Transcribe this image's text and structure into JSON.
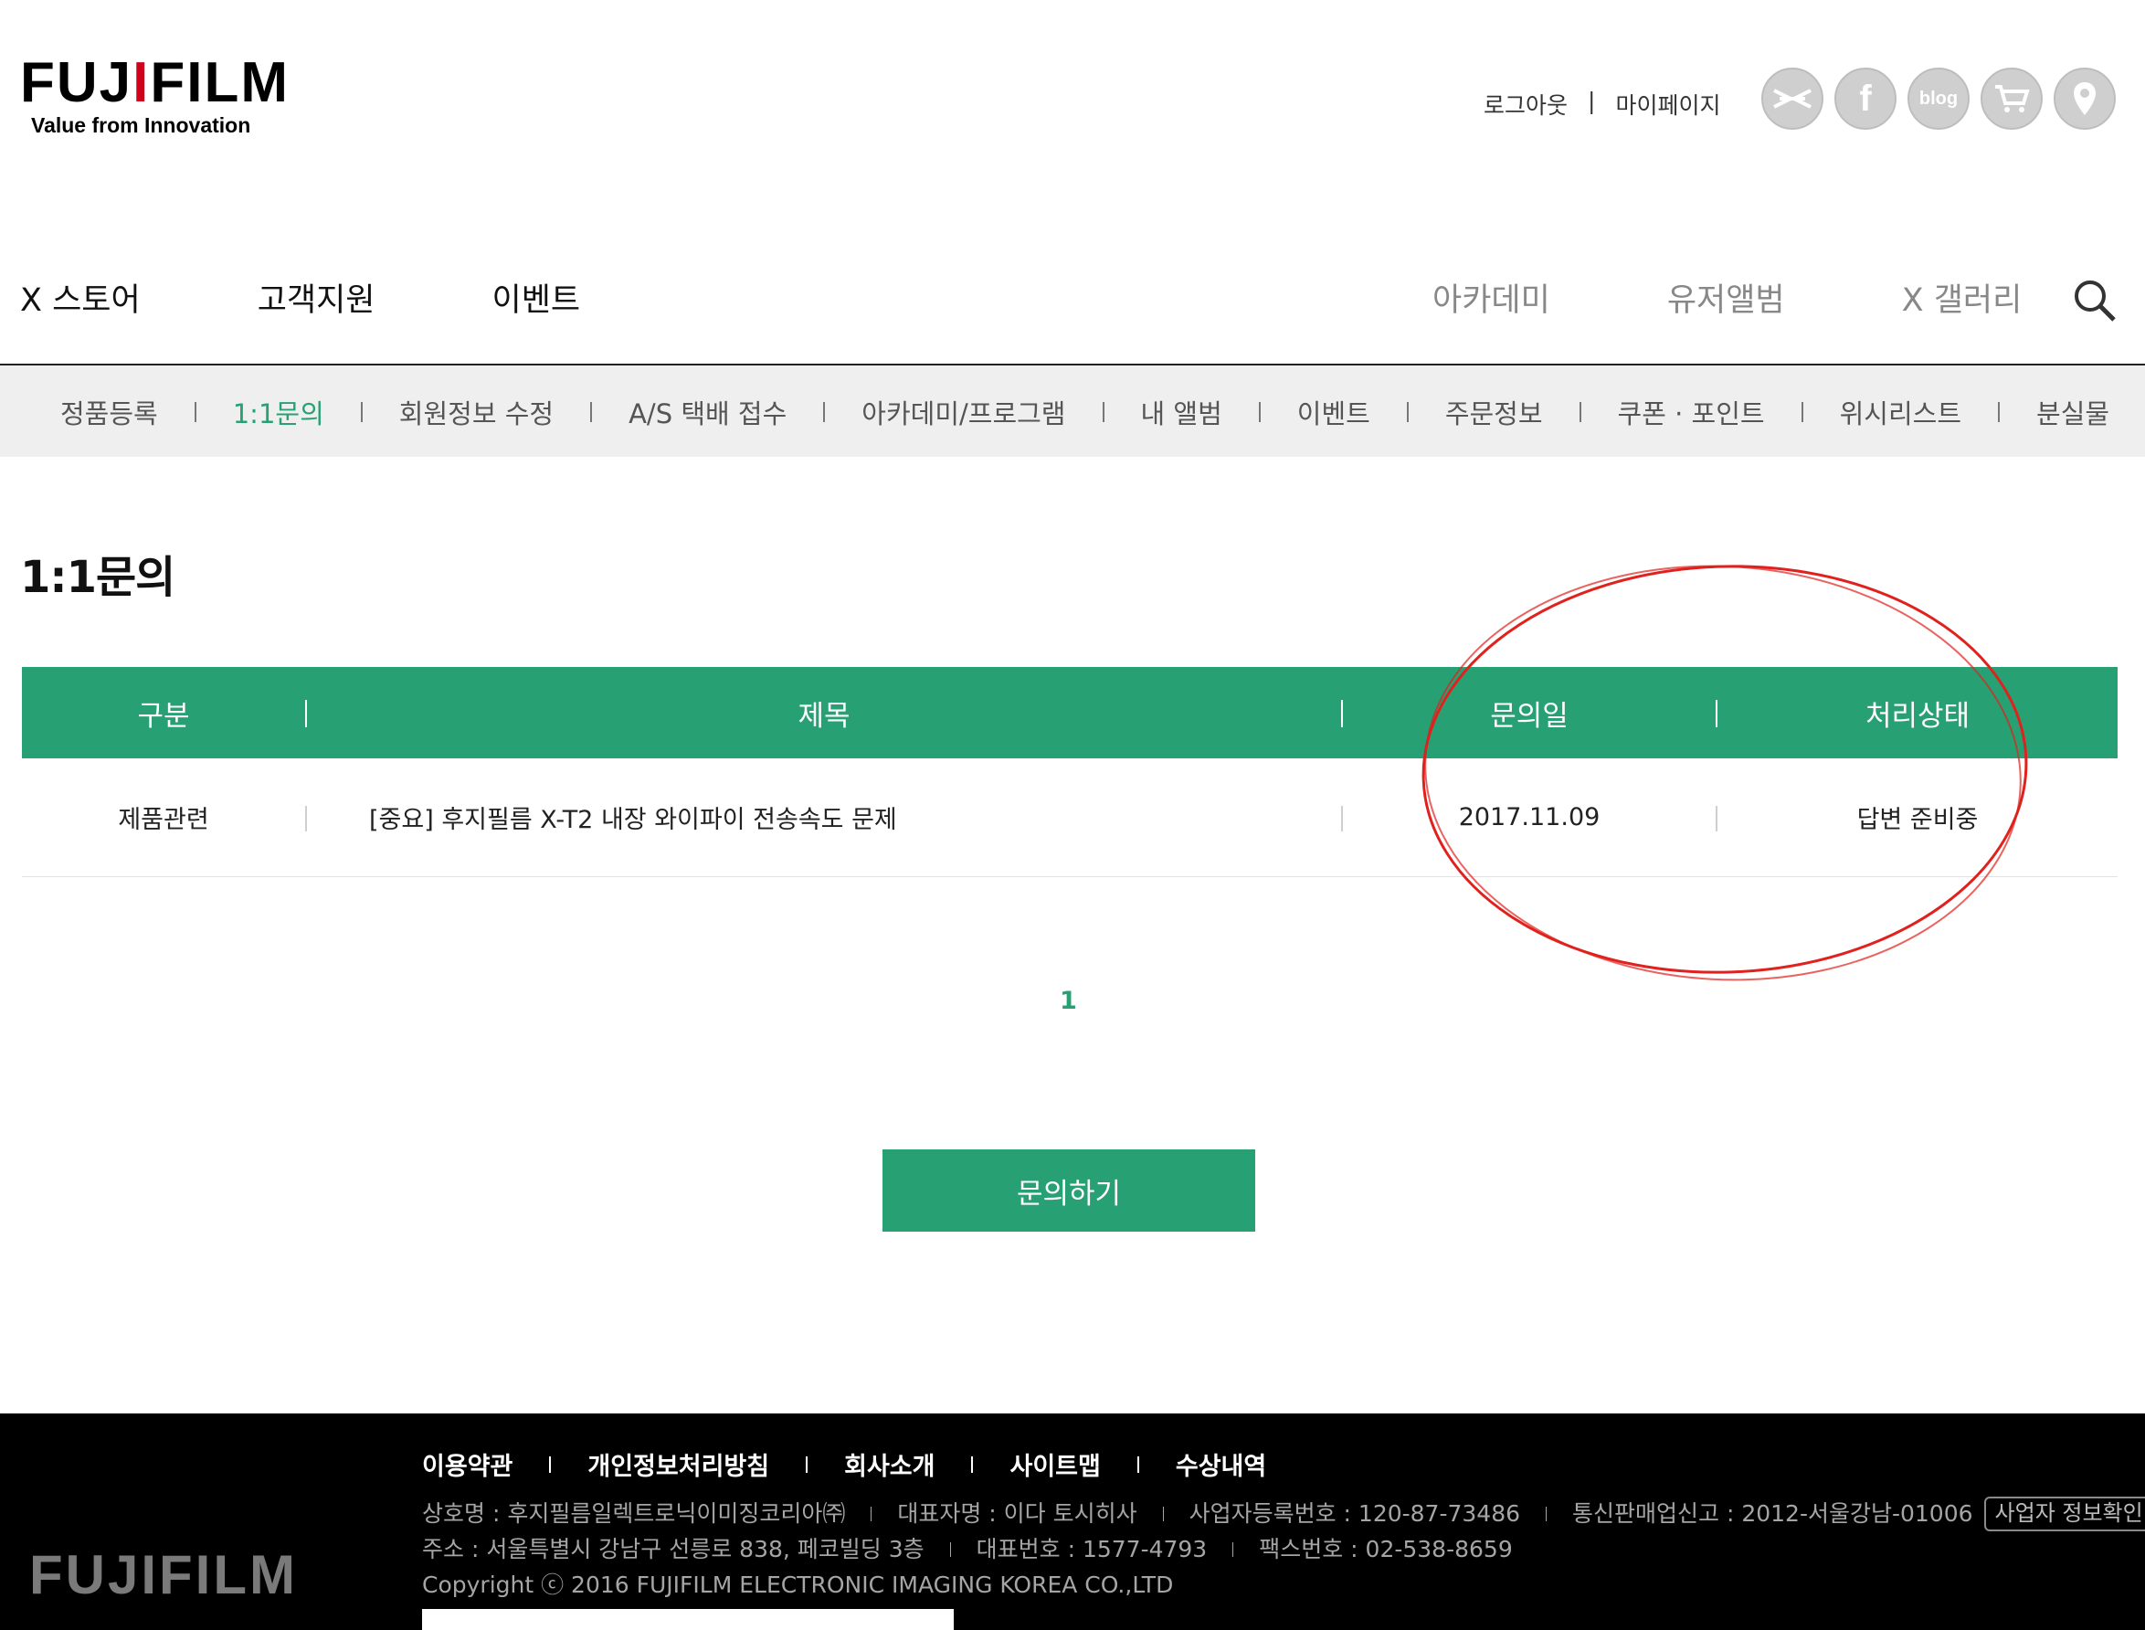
{
  "brand": {
    "logo_text_pre": "FUJ",
    "logo_text_i": "I",
    "logo_text_post": "FILM",
    "tagline": "Value from Innovation"
  },
  "top_links": {
    "logout": "로그아웃",
    "separator": "|",
    "mypage": "마이페이지"
  },
  "social": [
    {
      "icon": "x-store-icon",
      "label": ""
    },
    {
      "icon": "facebook-icon",
      "label": "f"
    },
    {
      "icon": "blog-icon",
      "label": "blog"
    },
    {
      "icon": "cart-icon",
      "label": ""
    },
    {
      "icon": "location-icon",
      "label": ""
    }
  ],
  "main_nav": [
    "X 스토어",
    "고객지원",
    "이벤트"
  ],
  "right_nav": [
    "아카데미",
    "유저앨범",
    "X 갤러리"
  ],
  "sub_nav": {
    "items": [
      "정품등록",
      "1:1문의",
      "회원정보 수정",
      "A/S 택배 접수",
      "아카데미/프로그램",
      "내 앨범",
      "이벤트",
      "주문정보",
      "쿠폰 · 포인트",
      "위시리스트",
      "분실물"
    ],
    "active": "1:1문의"
  },
  "page_title": "1:1문의",
  "table": {
    "headers": [
      "구분",
      "제목",
      "문의일",
      "처리상태"
    ],
    "rows": [
      {
        "category": "제품관련",
        "title": "[중요] 후지필름 X-T2 내장 와이파이 전송속도 문제",
        "date": "2017.11.09",
        "status": "답변 준비중"
      }
    ]
  },
  "pagination": {
    "current": "1"
  },
  "inquire_button": "문의하기",
  "footer": {
    "logo": "FUJIFILM",
    "links": [
      "이용약관",
      "개인정보처리방침",
      "회사소개",
      "사이트맵",
      "수상내역"
    ],
    "company": "상호명 : 후지필름일렉트로닉이미징코리아㈜",
    "ceo": "대표자명 : 이다 토시히사",
    "biz_no": "사업자등록번호 : 120-87-73486",
    "mail_order": "통신판매업신고 : 2012-서울강남-01006",
    "biz_check": "사업자 정보확인 ▸",
    "address": "주소 : 서울특별시 강남구 선릉로 838, 페코빌딩 3층",
    "phone": "대표번호 : 1577-4793",
    "fax": "팩스번호 : 02-538-8659",
    "copyright": "Copyright ⓒ 2016 FUJIFILM ELECTRONIC IMAGING KOREA CO.,LTD"
  },
  "colors": {
    "accent": "#27a074",
    "annotation": "#e0211d"
  }
}
